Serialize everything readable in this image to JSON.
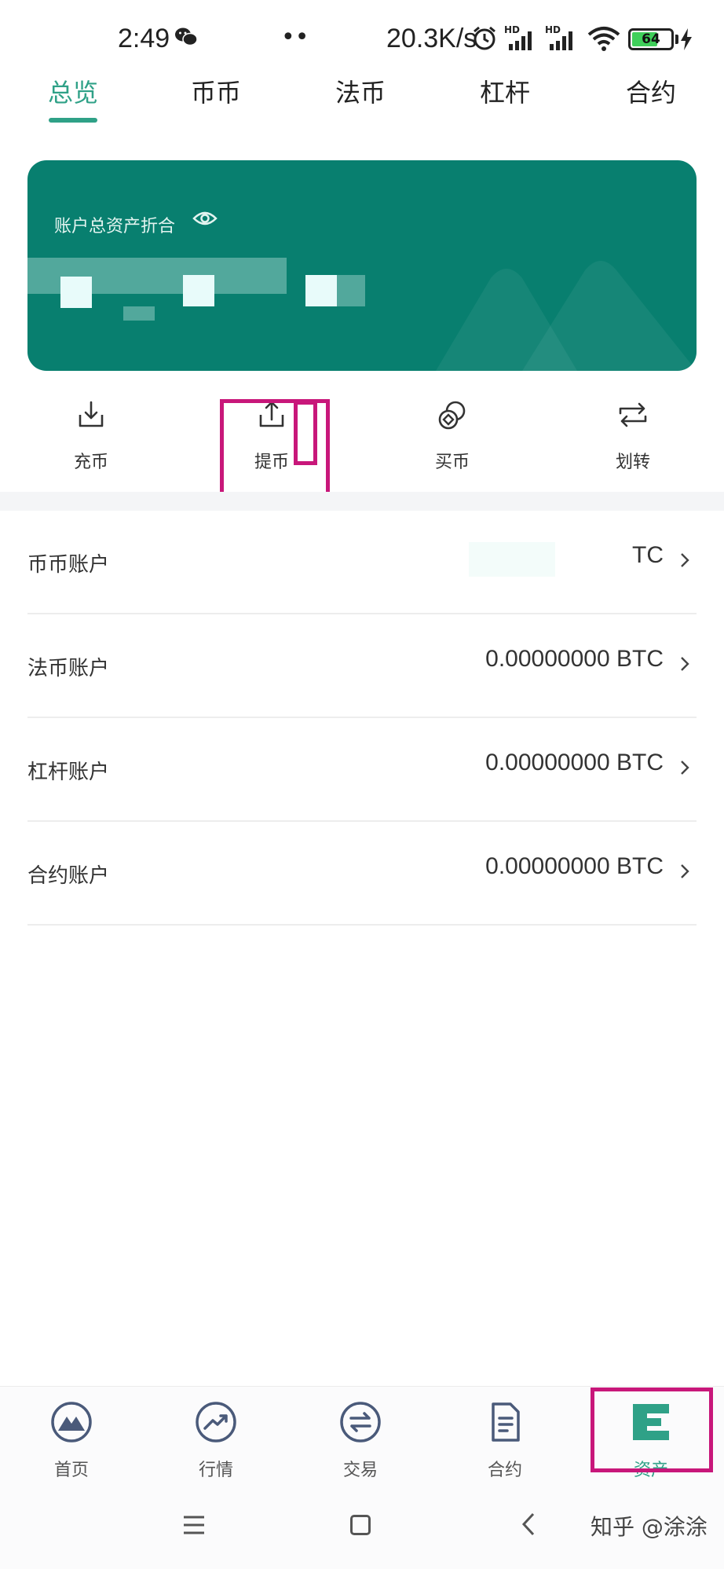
{
  "status_bar": {
    "time": "2:49",
    "dots": "••",
    "net_speed": "20.3K/s",
    "signal_badge": "HD",
    "battery_level": "64"
  },
  "tabs": [
    {
      "label": "总览",
      "active": true
    },
    {
      "label": "币币",
      "active": false
    },
    {
      "label": "法币",
      "active": false
    },
    {
      "label": "杠杆",
      "active": false
    },
    {
      "label": "合约",
      "active": false
    }
  ],
  "asset_card": {
    "label": "账户总资产折合",
    "background": "#087f6f"
  },
  "actions": [
    {
      "label": "充币",
      "icon": "deposit-icon"
    },
    {
      "label": "提币",
      "icon": "withdraw-icon"
    },
    {
      "label": "买币",
      "icon": "buy-coin-icon"
    },
    {
      "label": "划转",
      "icon": "transfer-icon"
    }
  ],
  "accounts": [
    {
      "name": "币币账户",
      "value": "TC"
    },
    {
      "name": "法币账户",
      "value": "0.00000000 BTC"
    },
    {
      "name": "杠杆账户",
      "value": "0.00000000 BTC"
    },
    {
      "name": "合约账户",
      "value": "0.00000000 BTC"
    }
  ],
  "bottom_nav": [
    {
      "label": "首页",
      "icon": "home-mountain-icon",
      "active": false
    },
    {
      "label": "行情",
      "icon": "market-trend-icon",
      "active": false
    },
    {
      "label": "交易",
      "icon": "trade-exchange-icon",
      "active": false
    },
    {
      "label": "合约",
      "icon": "contract-document-icon",
      "active": false
    },
    {
      "label": "资产",
      "icon": "assets-icon",
      "active": true
    }
  ],
  "watermark": "知乎 @涂涂",
  "colors": {
    "accent": "#2fa187",
    "card": "#087f6f",
    "highlight": "#c8177a"
  }
}
